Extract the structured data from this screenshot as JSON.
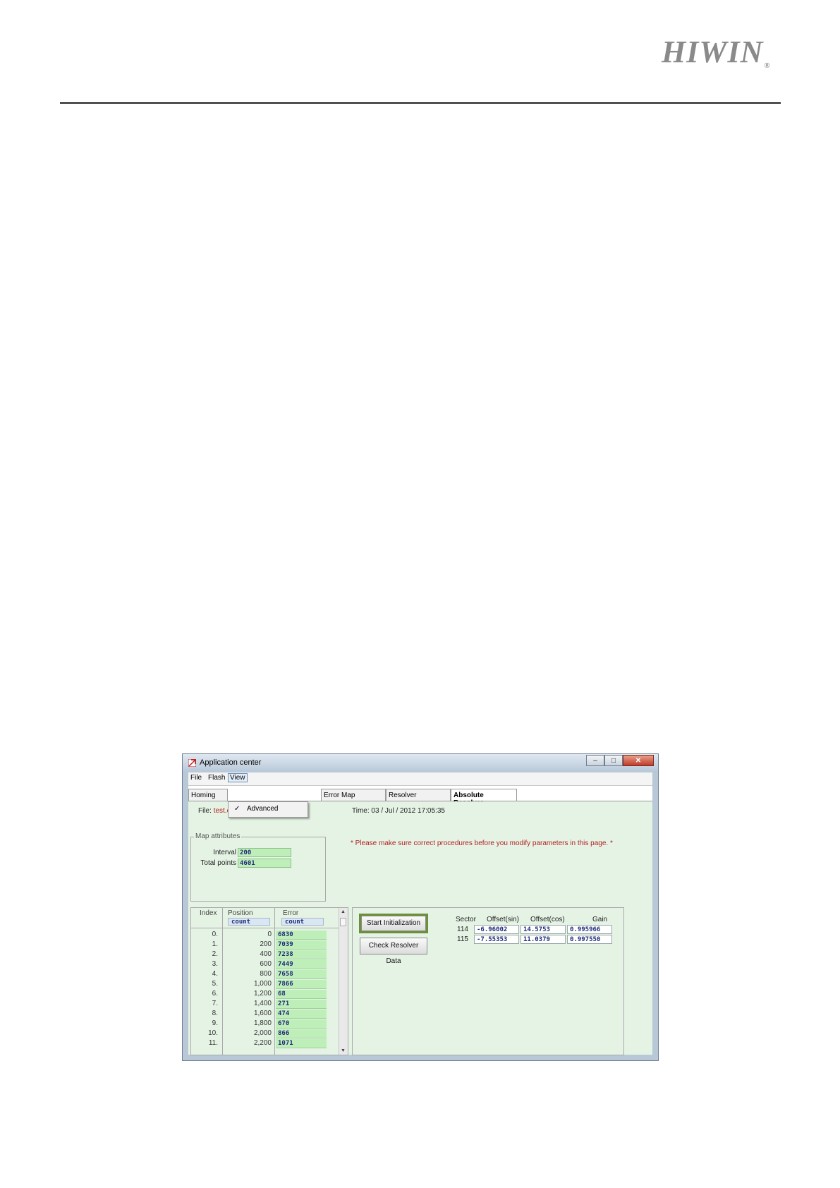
{
  "header": {
    "logo": "HIWIN",
    "reg": "®"
  },
  "window": {
    "title": "Application center",
    "menu": [
      "File",
      "Flash",
      "View"
    ],
    "view_menu_item": "Advanced",
    "view_menu_check": "✓",
    "tabs": [
      "Homing",
      "Error Map",
      "Resolver",
      "Absolute Resolver"
    ],
    "selected_tab": "Absolute Resolver",
    "file_label": "File:",
    "file_name": "test.emd",
    "time_label": "Time:",
    "time_value": "03 / Jul / 2012  17:05:35",
    "warning": "* Please make sure correct procedures before you modify parameters in this page. *",
    "map_attributes": {
      "legend": "Map attributes",
      "interval_label": "Interval",
      "interval_value": "200",
      "total_label": "Total points",
      "total_value": "4601"
    },
    "table": {
      "headers": [
        "Index",
        "Position",
        "Error"
      ],
      "units": [
        "count",
        "count"
      ],
      "rows": [
        {
          "idx": "0.",
          "pos": "0",
          "err": "6830"
        },
        {
          "idx": "1.",
          "pos": "200",
          "err": "7039"
        },
        {
          "idx": "2.",
          "pos": "400",
          "err": "7238"
        },
        {
          "idx": "3.",
          "pos": "600",
          "err": "7449"
        },
        {
          "idx": "4.",
          "pos": "800",
          "err": "7658"
        },
        {
          "idx": "5.",
          "pos": "1,000",
          "err": "7866"
        },
        {
          "idx": "6.",
          "pos": "1,200",
          "err": "68"
        },
        {
          "idx": "7.",
          "pos": "1,400",
          "err": "271"
        },
        {
          "idx": "8.",
          "pos": "1,600",
          "err": "474"
        },
        {
          "idx": "9.",
          "pos": "1,800",
          "err": "670"
        },
        {
          "idx": "10.",
          "pos": "2,000",
          "err": "866"
        },
        {
          "idx": "11.",
          "pos": "2,200",
          "err": "1071"
        }
      ]
    },
    "buttons": {
      "start": "Start Initialization",
      "check": "Check Resolver Data"
    },
    "resolver": {
      "headers": [
        "Sector",
        "Offset(sin)",
        "Offset(cos)",
        "Gain"
      ],
      "rows": [
        {
          "sector": "114",
          "sin": "-6.96002",
          "cos": "14.5753",
          "gain": "0.995966"
        },
        {
          "sector": "115",
          "sin": "-7.55353",
          "cos": "11.0379",
          "gain": "0.997550"
        }
      ]
    }
  },
  "colors": {
    "panel_bg": "#e5f3e5",
    "field_bg": "#bfefb9",
    "highlight": "#6e8f3a",
    "warning": "#b32020"
  }
}
